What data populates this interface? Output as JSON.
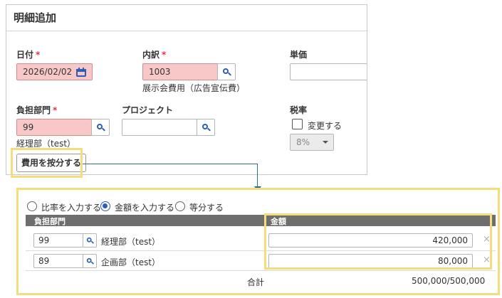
{
  "form": {
    "title": "明細追加",
    "date": {
      "label": "日付",
      "required": "*",
      "value": "2026/02/02"
    },
    "breakdown": {
      "label": "内訳",
      "required": "*",
      "value": "1003",
      "description": "展示会費用（広告宣伝費）"
    },
    "unit_price": {
      "label": "単価",
      "value": ""
    },
    "department": {
      "label": "負担部門",
      "required": "*",
      "value": "99",
      "description": "経理部（test）"
    },
    "project": {
      "label": "プロジェクト",
      "value": ""
    },
    "tax_rate": {
      "label": "税率",
      "change_label": "変更する",
      "selected": "8%"
    },
    "allocate_button": "費用を按分する"
  },
  "allocation": {
    "modes": [
      {
        "label": "比率を入力する",
        "selected": false
      },
      {
        "label": "金額を入力する",
        "selected": true
      },
      {
        "label": "等分する",
        "selected": false
      }
    ],
    "columns": {
      "department": "負担部門",
      "amount": "金額"
    },
    "rows": [
      {
        "code": "99",
        "name": "経理部（test）",
        "amount": "420,000"
      },
      {
        "code": "89",
        "name": "企画部（test）",
        "amount": "80,000"
      }
    ],
    "total_label": "合計",
    "total_value": "500,000/500,000",
    "remove_glyph": "×"
  },
  "colors": {
    "accent": "#2c5db8",
    "highlight": "#f5dd7e",
    "required_bg": "#f8c7c7",
    "connector": "#2a6f92"
  }
}
